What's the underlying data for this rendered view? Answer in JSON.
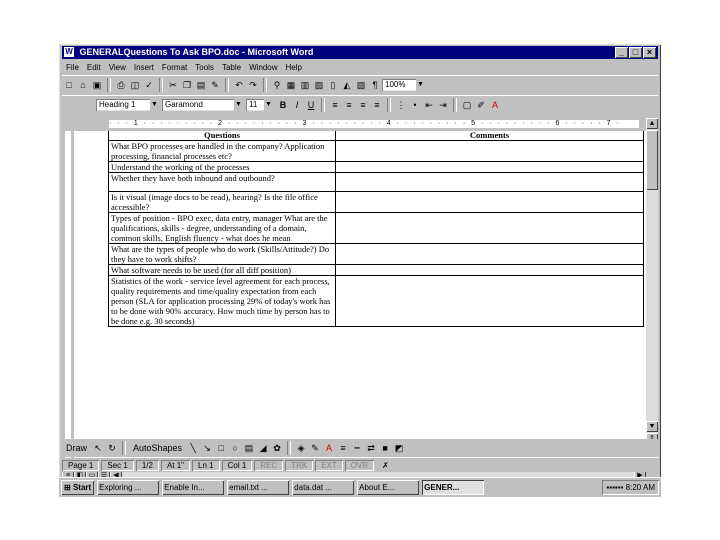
{
  "window": {
    "title": "GENERALQuestions To Ask BPO.doc - Microsoft Word",
    "buttons": [
      "_",
      "□",
      "×"
    ]
  },
  "menu": [
    "File",
    "Edit",
    "View",
    "Insert",
    "Format",
    "Tools",
    "Table",
    "Window",
    "Help"
  ],
  "toolbar": {
    "zoom": "100%",
    "style": "Heading 1",
    "font": "Garamond",
    "size": "11",
    "bold": "B",
    "italic": "I",
    "underline": "U"
  },
  "ruler": "· · · 1 · · · · · · · · · 2 · · · · · · · · · 3 · · · · · · · · · 4 · · · · · · · · · 5 · · · · · · · · · 6 · · · · · 7 ·",
  "table": {
    "headers": [
      "Questions",
      "Comments"
    ],
    "rows": [
      "What BPO processes are handled in the company? Application processing, financial processes etc?",
      "Understand the working of the processes",
      "Whether they have both inbound and outbound?",
      "Is it visual (image docs to be read), hearing? Is the file office accessible?",
      "Types of position - BPO exec, data entry, manager What are the qualifications, skills - degree, understanding of a domain, common skills, English fluency - what does he mean",
      "What are the types of people who do work (Skills/Attitude?) Do they have to work shifts?",
      "What software needs to be used (for all diff position)",
      "Statistics of the work - service level agreement for each process, quality requirements and time/quality expectation from each person (SLA for application processing 29% of today's work has to be done with 90% accuracy. How much time by person has to be done e.g. 30 seconds)"
    ]
  },
  "drawing": {
    "draw_label": "Draw",
    "autoshapes_label": "AutoShapes"
  },
  "status": {
    "page": "Page 1",
    "sec": "Sec 1",
    "pages": "1/2",
    "at": "At 1\"",
    "ln": "Ln 1",
    "col": "Col 1",
    "rec": "REC",
    "trk": "TRK",
    "ext": "EXT",
    "ovr": "OVR"
  },
  "taskbar": {
    "start": "Start",
    "tasks": [
      "Exploring ...",
      "Enable In...",
      "email.txt ...",
      "data.dat ...",
      "About E...",
      "GENER..."
    ],
    "clock": "8:20 AM"
  }
}
